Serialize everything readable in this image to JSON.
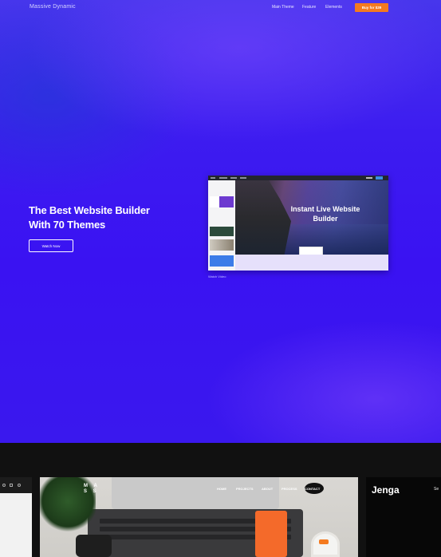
{
  "header": {
    "brand": "Massive Dynamic",
    "nav": [
      "Main Theme",
      "Feature",
      "Elements"
    ],
    "buy_label": "Buy for $39",
    "accent_color": "#f47a1f"
  },
  "hero": {
    "headline_line1": "The Best Website Builder",
    "headline_line2": "With 70 Themes",
    "watch_now_label": "Watch Now",
    "watch_video_label": "Watch Video",
    "background_color": "#3a18ee"
  },
  "preview": {
    "title_line1": "Instant Live Website",
    "title_line2": "Builder"
  },
  "showcase": {
    "main_card_logo": "M A\nS S",
    "main_card_nav": [
      "HOME",
      "PROJECTS",
      "ABOUT",
      "PROCESS",
      "CONTACT"
    ],
    "right_card_title": "Jenga",
    "right_card_nav": "Se"
  }
}
